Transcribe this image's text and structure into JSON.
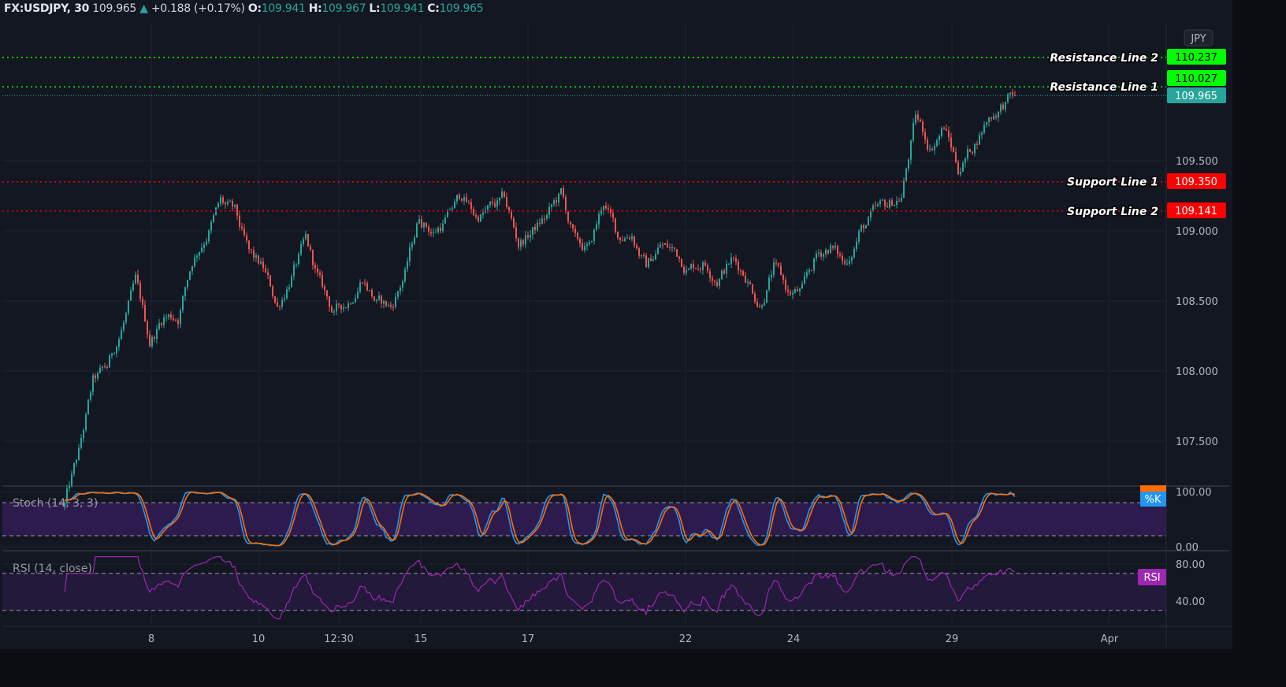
{
  "header": {
    "symbol": "FX:USDJPY, 30",
    "last": "109.965",
    "change_icon": "triangle-up-icon",
    "change": "+0.188 (+0.17%)",
    "o_label": "O:",
    "o": "109.941",
    "h_label": "H:",
    "h": "109.967",
    "l_label": "L:",
    "l": "109.941",
    "c_label": "C:",
    "c": "109.965"
  },
  "currency_button": "JPY",
  "colors": {
    "up": "#26a69a",
    "down": "#ef5350",
    "resistance": "#00ff00",
    "support": "#ff0000",
    "stoch_k": "#2196f3",
    "stoch_d": "#ff6d00",
    "rsi": "#9c27b0",
    "background": "#131722"
  },
  "price_axis": {
    "ticks": [
      "109.500",
      "109.000",
      "108.500",
      "108.000",
      "107.500"
    ]
  },
  "time_axis": {
    "ticks": [
      "8",
      "10",
      "12:30",
      "15",
      "17",
      "22",
      "24",
      "29",
      "Apr"
    ]
  },
  "lines": [
    {
      "name": "Resistance Line 2",
      "value": "110.237",
      "type": "resistance"
    },
    {
      "name": "Resistance Line 1",
      "value": "110.027",
      "type": "resistance"
    },
    {
      "name": "Support Line 1",
      "value": "109.350",
      "type": "support"
    },
    {
      "name": "Support Line 2",
      "value": "109.141",
      "type": "support"
    }
  ],
  "last_price_tag": "109.965",
  "stoch": {
    "legend": "Stoch (14, 3, 3)",
    "ticks": [
      "100.00",
      "0.00"
    ],
    "k_tag": "%K",
    "bands": [
      80,
      20
    ],
    "range": [
      0,
      100
    ]
  },
  "rsi": {
    "legend": "RSI (14, close)",
    "ticks": [
      "80.00",
      "40.00"
    ],
    "tag": "RSI",
    "bands": [
      70,
      30
    ]
  },
  "chart_data": {
    "type": "candlestick",
    "title": "FX:USDJPY, 30",
    "ylim": [
      107.0,
      110.35
    ],
    "close_path": [
      107.05,
      107.4,
      107.9,
      108.0,
      108.3,
      108.6,
      108.2,
      108.4,
      108.4,
      108.8,
      109.0,
      109.2,
      109.1,
      108.8,
      108.7,
      108.45,
      108.7,
      108.9,
      108.6,
      108.4,
      108.5,
      108.7,
      108.5,
      108.45,
      108.7,
      109.1,
      109.0,
      109.1,
      109.25,
      109.1,
      109.15,
      109.2,
      108.9,
      109.0,
      109.1,
      109.25,
      108.9,
      108.85,
      109.2,
      108.95,
      109.0,
      108.75,
      108.9,
      108.85,
      108.75,
      108.8,
      108.7,
      108.8,
      108.7,
      108.5,
      108.75,
      108.55,
      108.55,
      108.8,
      108.9,
      108.75,
      109.0,
      109.1,
      109.15,
      109.25,
      109.8,
      109.6,
      109.75,
      109.45,
      109.6,
      109.8,
      109.9,
      109.965
    ]
  }
}
